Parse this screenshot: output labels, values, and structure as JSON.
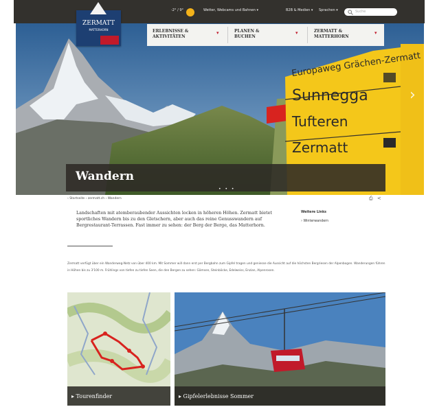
{
  "header": {
    "weather": "-2° / 9°",
    "menu_weather": "Wetter, Webcams und Bahnen ▾",
    "menu_b2b": "B2B & Medien ▾",
    "menu_language": "Sprachen ▾",
    "search_placeholder": "Suche"
  },
  "logo": {
    "name": "ZERMATT",
    "subtitle": "MATTERHORN"
  },
  "nav": {
    "items": [
      {
        "label": "ERLEBNISSE & AKTIVITÄTEN"
      },
      {
        "label": "PLANEN & BUCHEN"
      },
      {
        "label": "ZERMATT & MATTERHORN"
      }
    ]
  },
  "hero": {
    "title": "Wandern",
    "signs": [
      "Europaweg Grächen-Zermatt",
      "Sunnegga",
      "Tufteren",
      "Zermatt"
    ],
    "dots": "• • •"
  },
  "breadcrumb": "‹ Startseite › zermatt.ch › Wandern",
  "intro": "Landschaften mit atemberaubender Aussichten locken in höheren Höhen. Zermatt bietet sportliches Wandern bis zu den Gletschern, aber auch das reine Genusswandern auf Bergrestaurant-Terrassen. Fast immer zu sehen: der Berg der Berge, das Matterhorn.",
  "links": {
    "title": "Weitere Links",
    "item": "› Winterwandern"
  },
  "body": "Zermatt verfügt über ein Wanderweg-Netz von über 400 km. Mit Sommer will dann erst per Bergbahn zum Gipfel tragen und geniesse die Aussicht auf die höchsten Bergriesen der Alpenbogen. Wanderungen führen in Höhen bis zu 3'100 m. Frühlings von tiefen zu tiefen Seen, die den Bergen zu sehen: Gämsen, Steinböcke, Edelweiss, Enzian, Alpenrosen.",
  "tiles": [
    {
      "caption": "▸ Tourenfinder"
    },
    {
      "caption": "▸ Gipfelerlebnisse Sommer"
    }
  ]
}
